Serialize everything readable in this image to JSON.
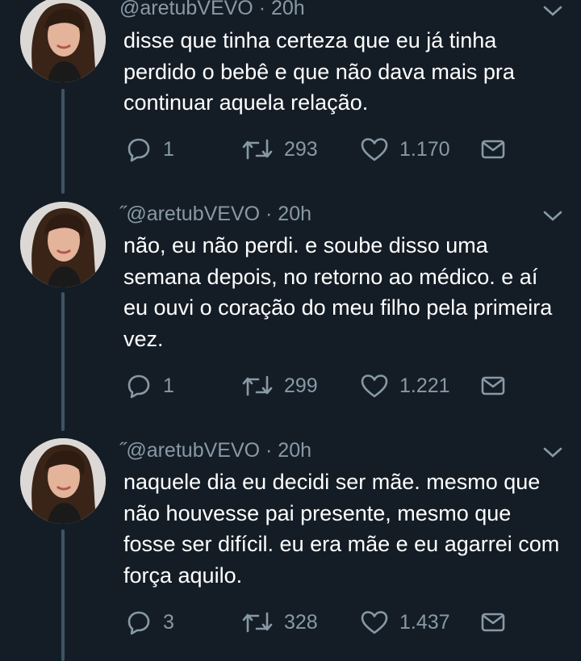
{
  "theme": {
    "background": "#141d26",
    "text": "#ffffff",
    "muted": "#8899a6",
    "thread": "#3d5466"
  },
  "tweets": [
    {
      "mark": "",
      "handle": "@aretubVEVO",
      "time": "· 20h",
      "text": "disse que tinha certeza que eu já tinha perdido o bebê e que não dava mais pra continuar aquela relação.",
      "replies": "1",
      "retweets": "293",
      "likes": "1.170"
    },
    {
      "mark": "˝",
      "handle": "@aretubVEVO",
      "time": "· 20h",
      "text": "não, eu não perdi. e soube disso uma semana depois, no retorno ao médico. e aí eu ouvi o coração do meu filho pela primeira vez.",
      "replies": "1",
      "retweets": "299",
      "likes": "1.221"
    },
    {
      "mark": "˝",
      "handle": "@aretubVEVO",
      "time": "· 20h",
      "text": "naquele dia eu decidi ser mãe. mesmo que não houvesse pai presente, mesmo que fosse ser difícil. eu era mãe e eu agarrei com força aquilo.",
      "replies": "3",
      "retweets": "328",
      "likes": "1.437"
    }
  ],
  "icons": {
    "reply": "reply-icon",
    "retweet": "retweet-icon",
    "like": "heart-icon",
    "dm": "envelope-icon",
    "menu": "chevron-down-icon"
  }
}
